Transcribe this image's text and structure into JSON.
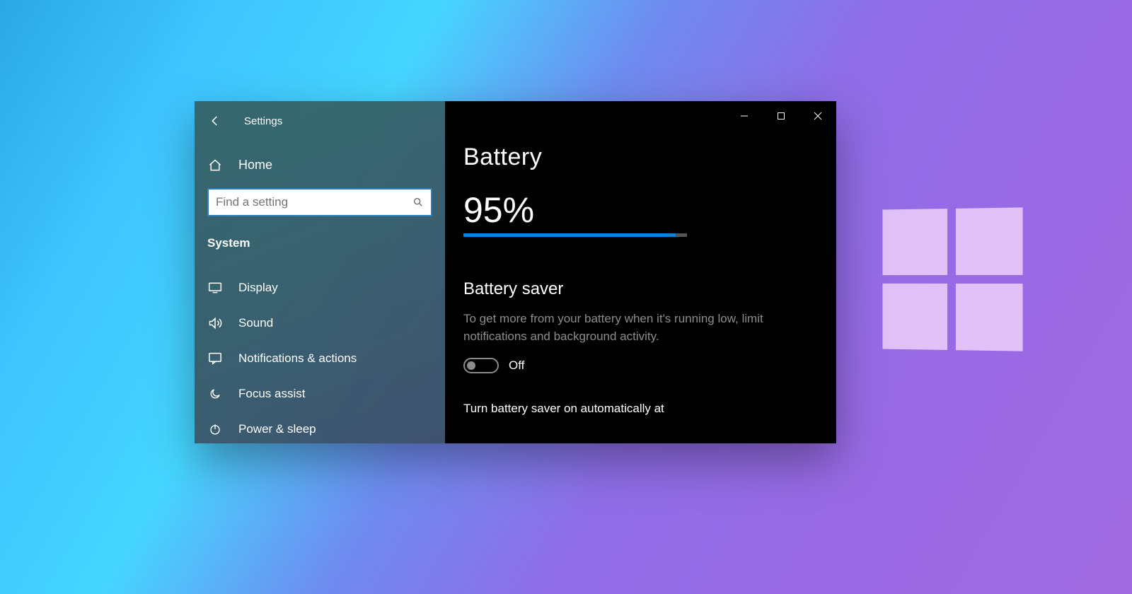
{
  "window": {
    "title": "Settings"
  },
  "sidebar": {
    "home": "Home",
    "search_placeholder": "Find a setting",
    "section": "System",
    "items": [
      {
        "label": "Display"
      },
      {
        "label": "Sound"
      },
      {
        "label": "Notifications & actions"
      },
      {
        "label": "Focus assist"
      },
      {
        "label": "Power & sleep"
      }
    ]
  },
  "main": {
    "title": "Battery",
    "percent_label": "95%",
    "percent_value": 95,
    "saver": {
      "heading": "Battery saver",
      "desc": "To get more from your battery when it's running low, limit notifications and background activity.",
      "toggle_label": "Off",
      "toggle_on": false
    },
    "auto_label": "Turn battery saver on automatically at"
  }
}
